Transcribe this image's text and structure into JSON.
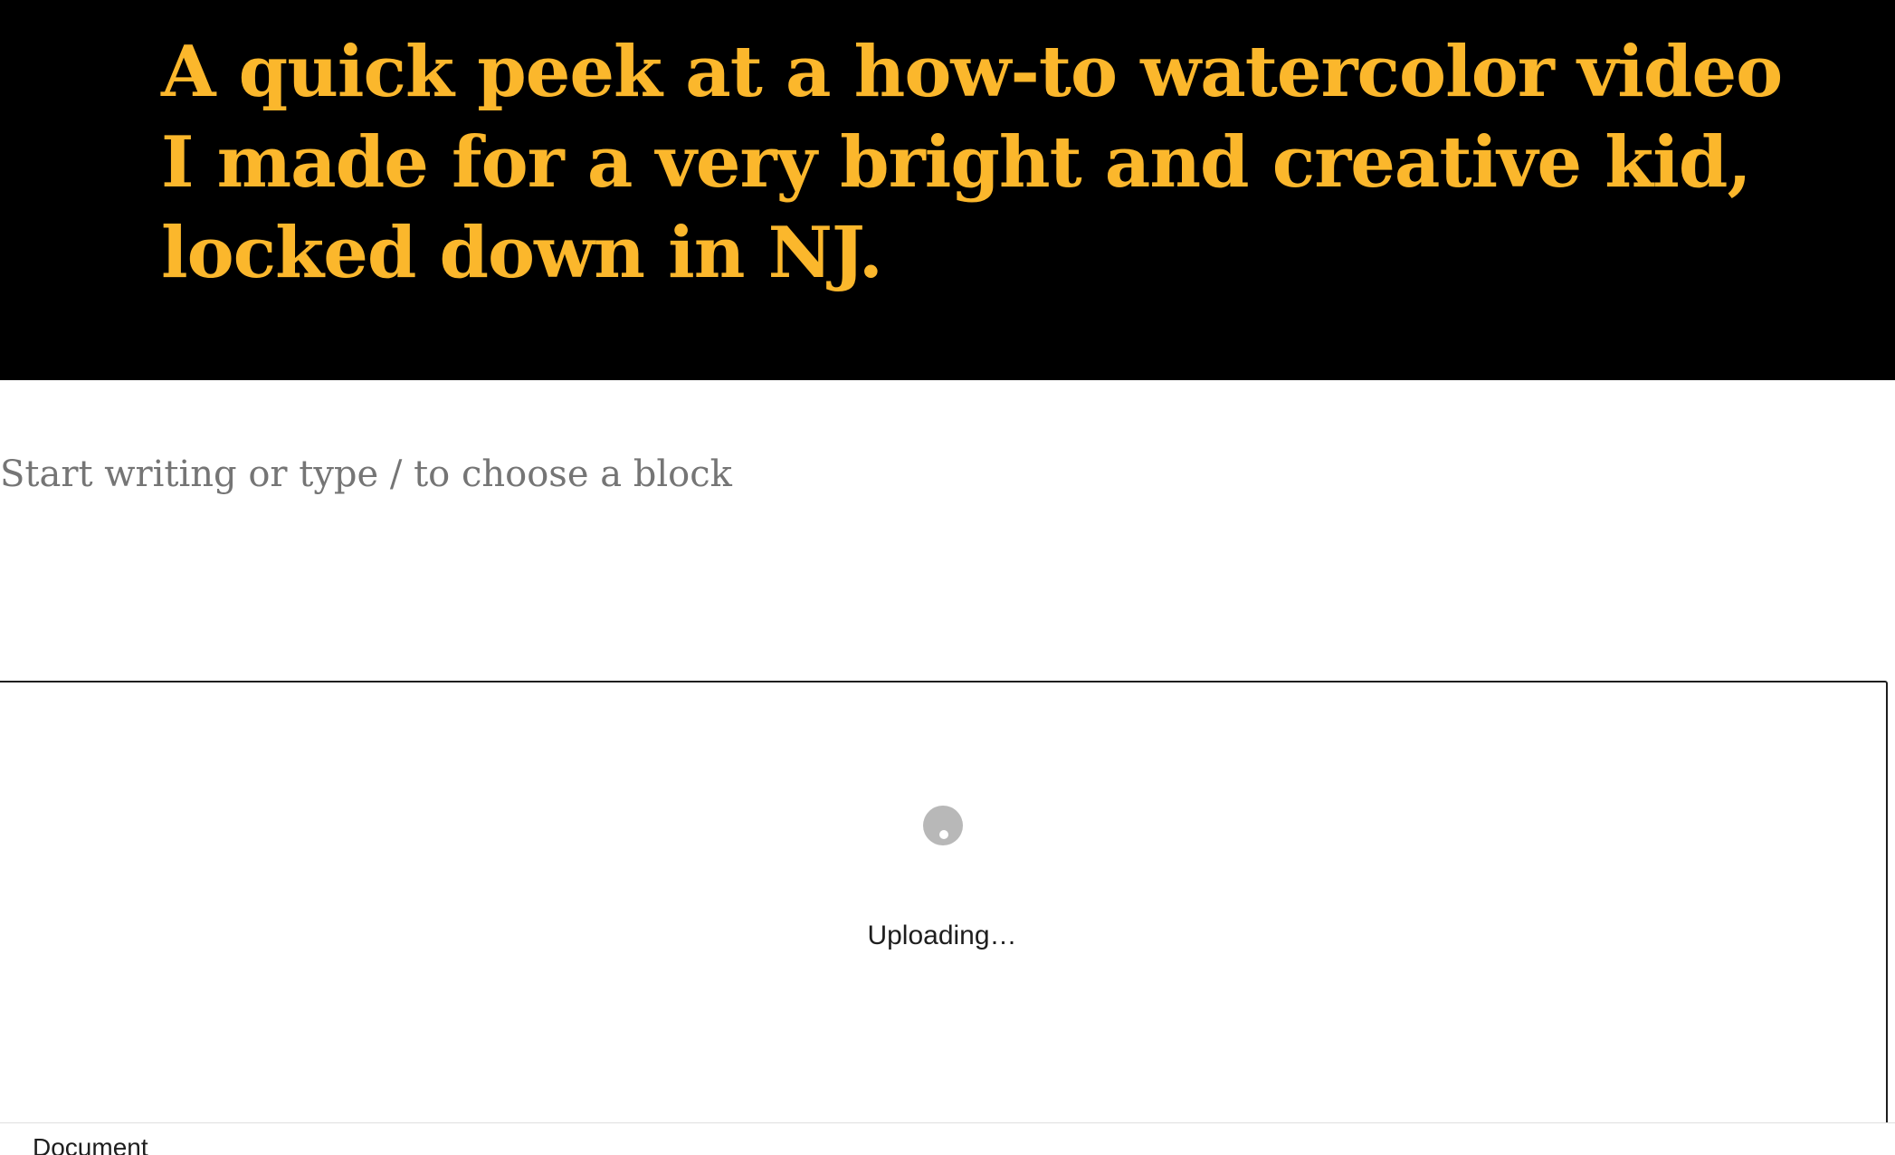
{
  "post": {
    "title": "A quick peek at a how-to watercolor video I made for a very bright and creative kid, locked down in NJ."
  },
  "editor": {
    "block_placeholder": "Start writing or type / to choose a block"
  },
  "video_block": {
    "status": "Uploading…"
  },
  "footer": {
    "breadcrumb": "Document"
  },
  "colors": {
    "title_text": "#fbb72c",
    "title_background": "#000000",
    "placeholder_text": "#757575",
    "spinner": "#b8b8b8"
  },
  "icons": {
    "spinner": "loading-spinner-icon"
  }
}
